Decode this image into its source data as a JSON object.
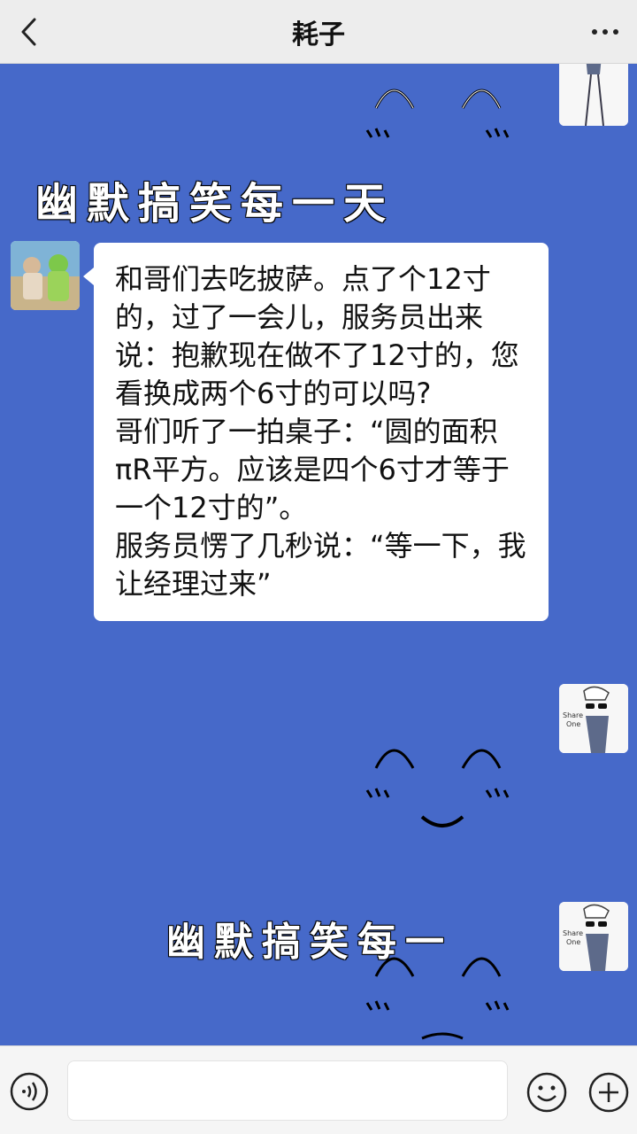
{
  "header": {
    "title": "耗子"
  },
  "chat": {
    "doodle_text_1": "幽默搞笑每一天",
    "doodle_text_2": "幽默搞笑每一",
    "avatar_badge_text": "Share One",
    "message": {
      "paragraphs": [
        "和哥们去吃披萨。点了个12寸的，过了一会儿，服务员出来说：抱歉现在做不了12寸的，您看换成两个6寸的可以吗?",
        "哥们听了一拍桌子：“圆的面积πR平方。应该是四个6寸才等于一个12寸的”。",
        "服务员愣了几秒说：“等一下，我让经理过来”"
      ]
    }
  },
  "input": {
    "placeholder": ""
  },
  "colors": {
    "chat_background": "#4669c9",
    "header_background": "#ededed",
    "bubble_background": "#ffffff"
  },
  "icons": {
    "back": "chevron-left-icon",
    "more": "more-dots-icon",
    "voice": "voice-icon",
    "emoji": "emoji-icon",
    "plus": "plus-icon"
  }
}
